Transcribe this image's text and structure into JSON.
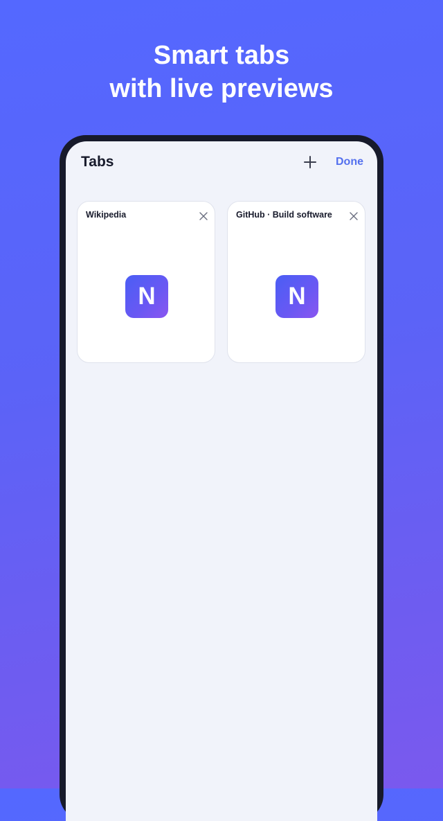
{
  "headline": {
    "line1": "Smart tabs",
    "line2": "with live previews"
  },
  "tabs_screen": {
    "title": "Tabs",
    "new_tab_icon": "plus-icon",
    "done_label": "Done",
    "tabs": [
      {
        "title": "Wikipedia",
        "preview_letter": "N",
        "close_icon": "close-icon"
      },
      {
        "title": "GitHub · Build software",
        "preview_letter": "N",
        "close_icon": "close-icon"
      }
    ]
  },
  "colors": {
    "background": "#5468ff",
    "accent": "#5470ee",
    "text_dark": "#171a2b",
    "screen_bg": "#f1f3fa"
  }
}
